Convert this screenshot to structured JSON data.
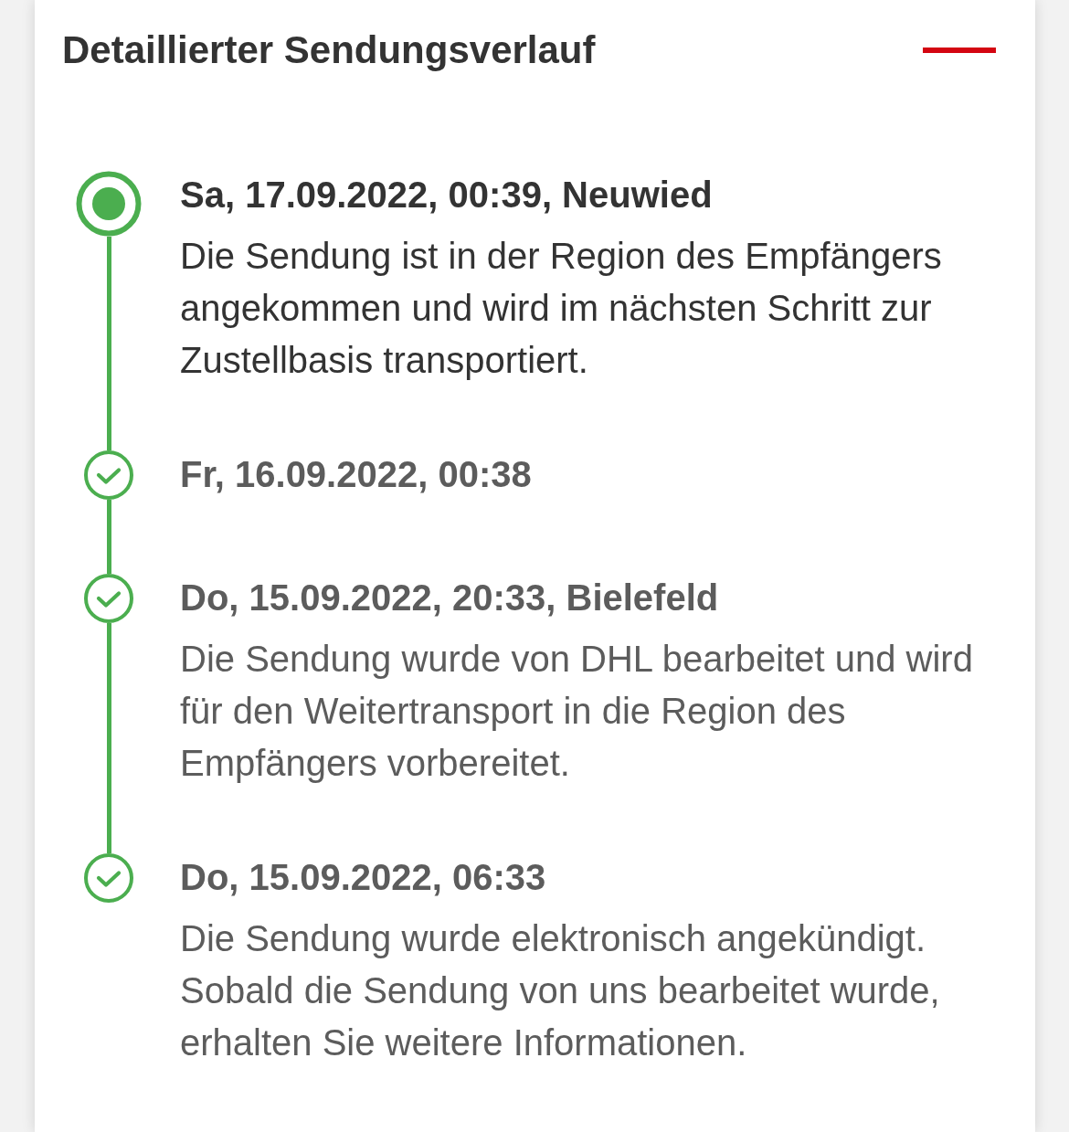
{
  "section": {
    "title": "Detaillierter Sendungsverlauf",
    "expanded": true
  },
  "events": [
    {
      "title": "Sa, 17.09.2022, 00:39, Neuwied",
      "description": "Die Sendung ist in der Region des Empfängers angekommen und wird im nächsten Schritt zur Zustellbasis transportiert.",
      "current": true
    },
    {
      "title": "Fr, 16.09.2022, 00:38",
      "current": false
    },
    {
      "title": "Do, 15.09.2022, 20:33, Bielefeld",
      "description": "Die Sendung wurde von DHL bearbeitet und wird für den Weitertransport in die Region des Empfängers vorbereitet.",
      "current": false
    },
    {
      "title": "Do, 15.09.2022, 06:33",
      "description": "Die Sendung wurde elektronisch angekündigt. Sobald die Sendung von uns bearbeitet wurde, erhalten Sie weitere Informationen.",
      "current": false
    }
  ]
}
